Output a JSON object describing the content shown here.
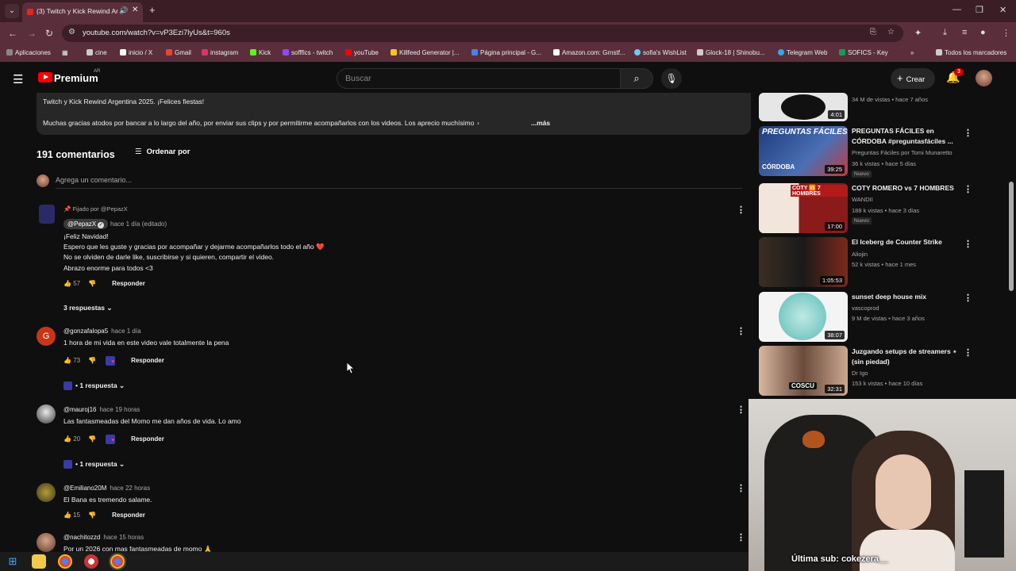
{
  "browser": {
    "tab_title": "(3) Twitch y Kick Rewind Ar",
    "url": "youtube.com/watch?v=vP3Ezi7lyUs&t=960s",
    "bookmarks": [
      {
        "label": "Aplicaciones",
        "color": "#888888"
      },
      {
        "label": "cine",
        "color": "#cccccc"
      },
      {
        "label": "inicio / X",
        "color": "#ffffff"
      },
      {
        "label": "Gmail",
        "color": "#ea4335"
      },
      {
        "label": "instagram",
        "color": "#e1306c"
      },
      {
        "label": "Kick",
        "color": "#53fc18"
      },
      {
        "label": "sofffics - twitch",
        "color": "#9146ff"
      },
      {
        "label": "youTube",
        "color": "#ff0000"
      },
      {
        "label": "Killfeed Generator |...",
        "color": "#f5c518"
      },
      {
        "label": "Página principal - G...",
        "color": "#4285f4"
      },
      {
        "label": "Amazon.com: Grnstf...",
        "color": "#ffffff"
      },
      {
        "label": "sofia's WishList",
        "color": "#66ccff"
      },
      {
        "label": "Glock-18 | Shinobu...",
        "color": "#cccccc"
      },
      {
        "label": "Telegram Web",
        "color": "#2aabee"
      },
      {
        "label": "SOFICS - Key",
        "color": "#0f9d58"
      }
    ],
    "all_bookmarks": "Todos los marcadores"
  },
  "youtube": {
    "brand": "Premium",
    "country": "AR",
    "search_placeholder": "Buscar",
    "create_label": "Crear",
    "notif_count": "3"
  },
  "description": {
    "line1": "Twitch y Kick  Rewind Argentina 2025. ¡Felices fiestas!",
    "line2": "Muchas gracias atodos por bancar a lo largo del año, por enviar sus clips y por permitirme acompañarlos con los videos. Los aprecio muchísimo",
    "more": "...más"
  },
  "comments_header": {
    "count": "191 comentarios",
    "sort": "Ordenar por",
    "add_placeholder": "Agrega un comentario..."
  },
  "comments": [
    {
      "pinned": "Fijado por @PepazX",
      "author": "@PepazX",
      "time": "hace 1 día (editado)",
      "lines": [
        "¡Feliz Navidad!",
        "Espero que les guste y gracias por acompañar y dejarme acompañarlos todo el año ❤️",
        "No se olviden de darle like, suscribirse y si quieren, compartir el video.",
        "Abrazo enorme para todos <3"
      ],
      "likes": "57",
      "reply": "Responder",
      "replies": "3 respuestas"
    },
    {
      "author": "@gonzafalopa5",
      "time": "hace 1 día",
      "text": "1 hora de mi vida en este video vale totalmente la pena",
      "likes": "73",
      "reply": "Responder",
      "replies": "1 respuesta",
      "avatar_letter": "G"
    },
    {
      "author": "@mauroj16",
      "time": "hace 19 horas",
      "text": "Las fantasmeadas del Momo me dan años de vida. Lo amo",
      "likes": "20",
      "reply": "Responder",
      "replies": "1 respuesta"
    },
    {
      "author": "@Emiliano20M",
      "time": "hace 22 horas",
      "text": "El Bana es tremendo salame.",
      "likes": "15",
      "reply": "Responder"
    },
    {
      "author": "@nachitozzd",
      "time": "hace 15 horas",
      "text": "Por un 2026 con mas fantasmeadas de momo 🙏"
    }
  ],
  "sidebar": [
    {
      "title": "",
      "channel": "",
      "meta": "34 M de vistas • hace 7 años",
      "duration": "4:01"
    },
    {
      "title": "PREGUNTAS FÁCILES en CÓRDOBA #preguntasfáciles ...",
      "channel": "Preguntas Fáciles por Tomi Munaretto",
      "meta": "36 k vistas • hace 5 días",
      "badge": "Nuevo",
      "duration": "39:25"
    },
    {
      "title": "COTY ROMERO vs 7 HOMBRES",
      "channel": "WANDII",
      "meta": "188 k vistas • hace 3 días",
      "badge": "Nuevo",
      "duration": "17:00"
    },
    {
      "title": "El Iceberg de Counter Strike",
      "channel": "Aliojin",
      "meta": "52 k vistas • hace 1 mes",
      "duration": "1:05:53"
    },
    {
      "title": "sunset deep house mix",
      "channel": "vascoprod",
      "meta": "9 M de vistas • hace 3 años",
      "duration": "38:07"
    },
    {
      "title": "Juzgando setups de streamers ⋆ (sin piedad)",
      "channel": "Dr Igo",
      "meta": "153 k vistas • hace 10 días",
      "duration": "32:31"
    }
  ],
  "thumb_texts": {
    "preguntas": "PREGUNTAS FÁCILES",
    "cordoba": "CÓRDOBA",
    "coty": "COTY 🆚 7 HOMBRES",
    "coscu": "COSCU"
  },
  "webcam": {
    "overlay": "Última sub: cokezera__"
  }
}
